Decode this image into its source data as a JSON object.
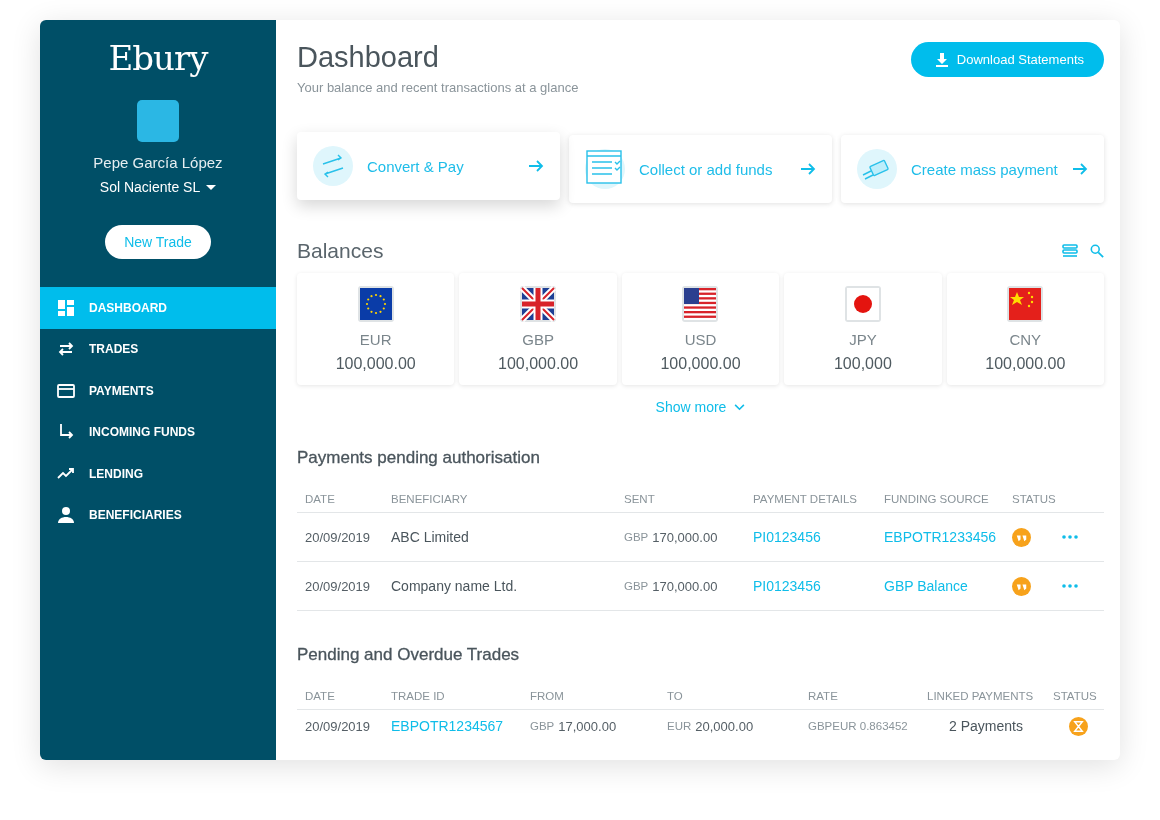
{
  "sidebar": {
    "logo": "Ebury",
    "user_name": "Pepe García López",
    "company": "Sol Naciente SL",
    "new_trade_button": "New Trade",
    "items": [
      {
        "label": "DASHBOARD",
        "kind": "dashboard",
        "selected": true
      },
      {
        "label": "TRADES",
        "kind": "trades",
        "selected": false
      },
      {
        "label": "PAYMENTS",
        "kind": "payments",
        "selected": false
      },
      {
        "label": "INCOMING FUNDS",
        "kind": "incoming",
        "selected": false
      },
      {
        "label": "LENDING",
        "kind": "lending",
        "selected": false
      },
      {
        "label": "BENEFICIARIES",
        "kind": "beneficiaries",
        "selected": false
      }
    ]
  },
  "header": {
    "title": "Dashboard",
    "subtitle": "Your balance and recent transactions at a glance",
    "download_button": "Download Statements"
  },
  "actions": [
    {
      "label": "Convert & Pay",
      "kind": "convert"
    },
    {
      "label": "Collect or add funds",
      "kind": "collect"
    },
    {
      "label": "Create mass payment",
      "kind": "mass"
    }
  ],
  "balances": {
    "title": "Balances",
    "show_more": "Show more",
    "items": [
      {
        "currency": "EUR",
        "amount": "100,000.00",
        "kind": "eur"
      },
      {
        "currency": "GBP",
        "amount": "100,000.00",
        "kind": "gbp"
      },
      {
        "currency": "USD",
        "amount": "100,000.00",
        "kind": "usd"
      },
      {
        "currency": "JPY",
        "amount": "100,000",
        "kind": "jpy"
      },
      {
        "currency": "CNY",
        "amount": "100,000.00",
        "kind": "cny"
      }
    ]
  },
  "payments": {
    "title": "Payments pending authorisation",
    "columns": [
      "DATE",
      "BENEFICIARY",
      "SENT",
      "PAYMENT DETAILS",
      "FUNDING SOURCE",
      "STATUS"
    ],
    "rows": [
      {
        "date": "20/09/2019",
        "beneficiary": "ABC Limited",
        "sent_currency": "GBP",
        "sent_amount": "170,000.00",
        "details": "PI0123456",
        "funding": "EBPOTR1233456",
        "kind": "authorise"
      },
      {
        "date": "20/09/2019",
        "beneficiary": "Company name Ltd.",
        "sent_currency": "GBP",
        "sent_amount": "170,000.00",
        "details": "PI0123456",
        "funding": "GBP Balance",
        "kind": "authorise"
      }
    ]
  },
  "trades": {
    "title": "Pending and Overdue Trades",
    "columns": [
      "DATE",
      "TRADE ID",
      "FROM",
      "TO",
      "RATE",
      "LINKED PAYMENTS",
      "STATUS"
    ],
    "rows": [
      {
        "date": "20/09/2019",
        "trade_id": "EBPOTR1234567",
        "from_currency": "GBP",
        "from_amount": "17,000.00",
        "to_currency": "EUR",
        "to_amount": "20,000.00",
        "rate": "GBPEUR 0.863452",
        "linked": "2 Payments",
        "kind": "pending"
      }
    ]
  }
}
